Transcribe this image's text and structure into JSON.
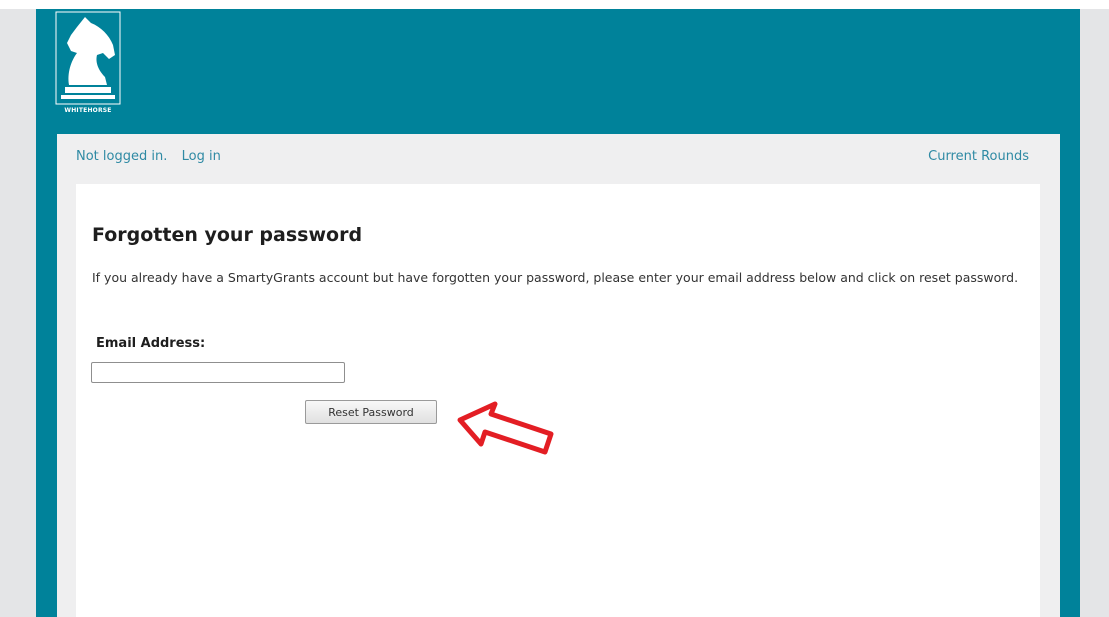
{
  "brand": {
    "logo_text": "WHITEHORSE"
  },
  "nav": {
    "status_text": "Not logged in.",
    "login_link": "Log in",
    "current_rounds_link": "Current Rounds"
  },
  "form": {
    "title": "Forgotten your password",
    "intro": "If you already have a SmartyGrants account but have forgotten your password, please enter your email address below and click on reset password.",
    "email_label": "Email Address:",
    "email_value": "",
    "submit_label": "Reset Password"
  },
  "annotation": {
    "arrow_icon": "arrow-pointing-left-icon",
    "arrow_color": "#e31e24"
  },
  "colors": {
    "header_teal": "#00829a",
    "link_blue": "#2f8aa4"
  }
}
